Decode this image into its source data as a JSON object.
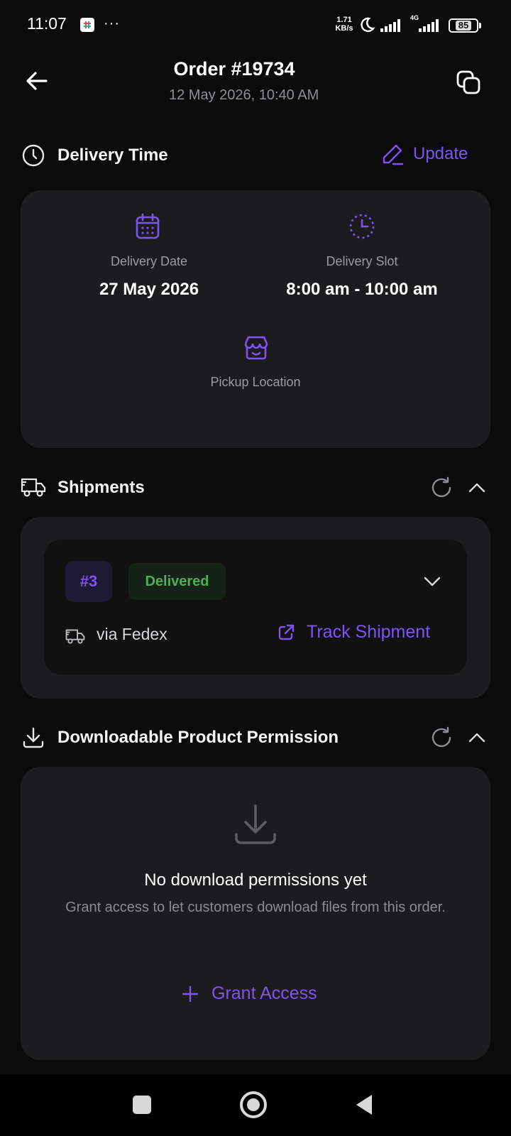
{
  "status_bar": {
    "time": "11:07",
    "more": "···",
    "net_speed_value": "1.71",
    "net_speed_unit": "KB/s",
    "network_label": "4G",
    "battery": "85"
  },
  "header": {
    "title": "Order #19734",
    "subtitle": "12 May 2026, 10:40 AM"
  },
  "delivery": {
    "section_title": "Delivery Time",
    "update_label": "Update",
    "date_label": "Delivery Date",
    "date_value": "27 May 2026",
    "slot_label": "Delivery Slot",
    "slot_value": "8:00 am - 10:00 am",
    "pickup_label": "Pickup Location"
  },
  "shipments": {
    "section_title": "Shipments",
    "items": [
      {
        "number": "#3",
        "status": "Delivered",
        "carrier": "via Fedex",
        "track_label": "Track Shipment"
      }
    ]
  },
  "downloads": {
    "section_title": "Downloadable Product Permission",
    "empty_title": "No download permissions yet",
    "empty_desc": "Grant access to let customers download files from this order.",
    "grant_label": "Grant Access"
  },
  "colors": {
    "accent": "#7b55f2",
    "success": "#4caf50",
    "card": "#1c1c1e",
    "background": "#0b0b0c"
  },
  "icons": {
    "back": "arrow-left-icon",
    "copy": "copy-icon",
    "clock": "clock-icon",
    "edit": "pencil-icon",
    "calendar": "calendar-icon",
    "slot": "clock-dashed-icon",
    "store": "store-icon",
    "truck": "truck-icon",
    "refresh": "refresh-icon",
    "collapse": "chevron-up-icon",
    "expand": "chevron-down-icon",
    "external": "external-link-icon",
    "download": "download-icon",
    "plus": "plus-icon"
  }
}
